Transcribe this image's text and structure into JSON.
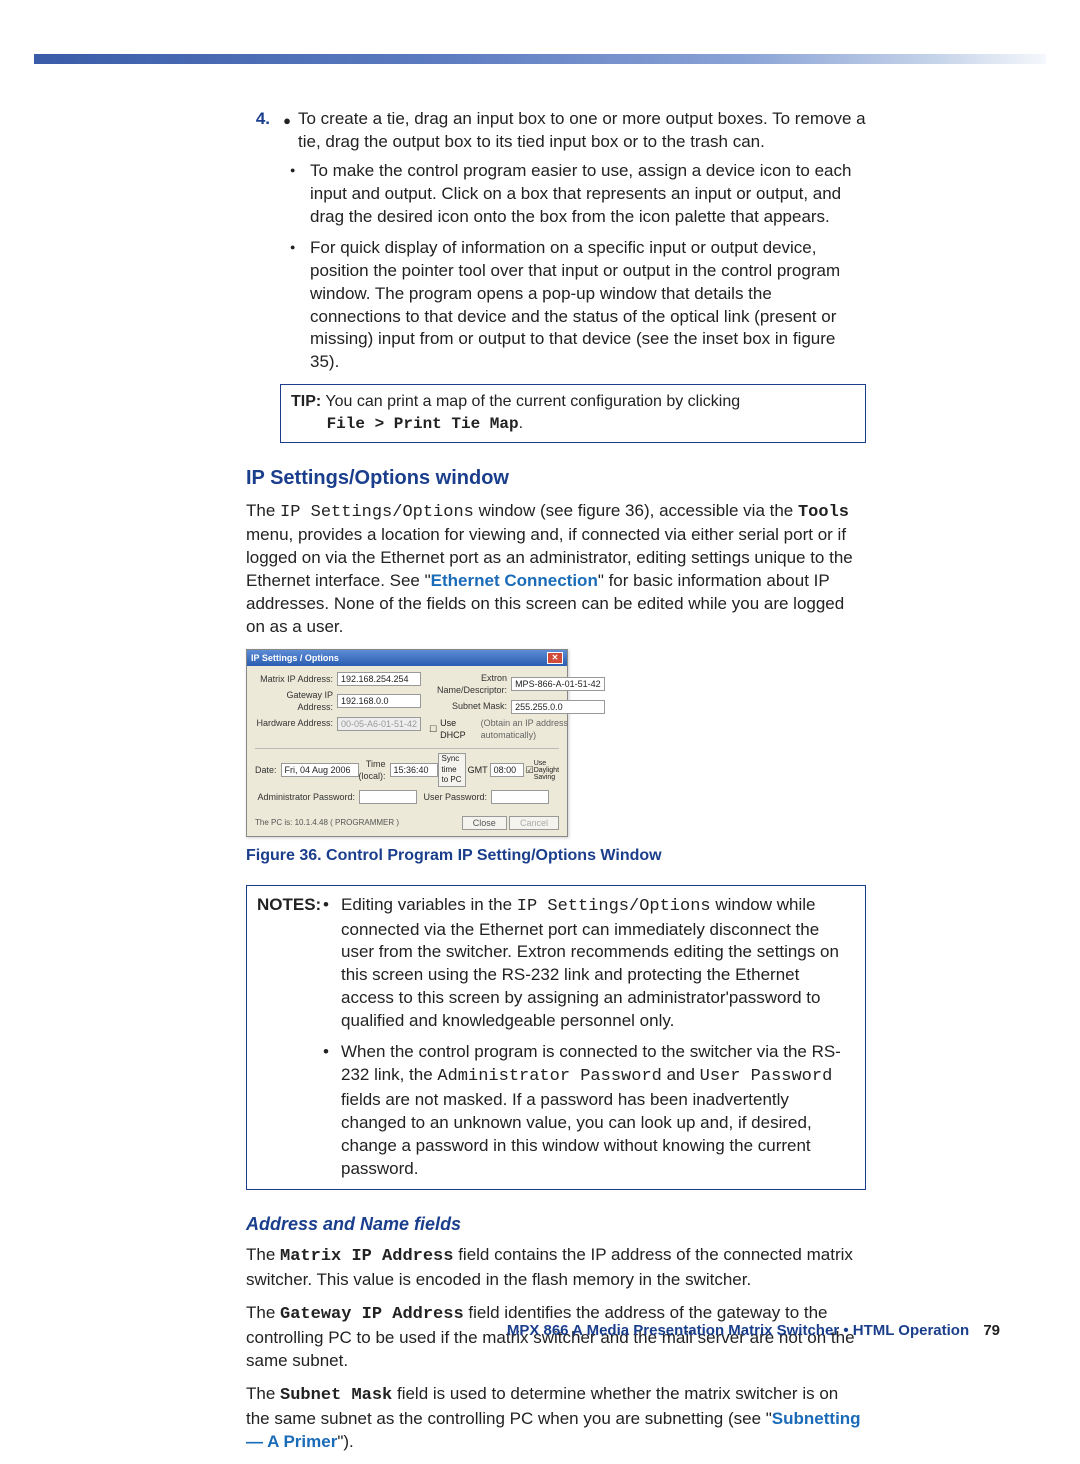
{
  "step4": {
    "number": "4.",
    "text": "To create a tie, drag an input box to one or more output boxes. To remove a tie, drag the output box to its tied input box or to the trash can.",
    "sub": [
      "To make the control program easier to use, assign a device icon to each input and output. Click on a box that represents an input or output, and drag the desired icon onto the box from the icon palette that appears.",
      "For quick display of information on a specific input or output device, position the pointer tool over that input or output in the control program window. The program opens a pop-up window that details the connections to that device and the status of the optical link (present or missing) input from or output to that device (see the inset box in figure 35)."
    ]
  },
  "tip": {
    "label": "TIP:",
    "text": "You can print a map of the current configuration by clicking ",
    "mono": "File > Print Tie Map",
    "tail": "."
  },
  "section": {
    "title": "IP Settings/Options window",
    "para_a": "The ",
    "mono1": "IP Settings/Options",
    "para_b": " window (see figure 36), accessible via the ",
    "mono2": "Tools",
    "para_c": " menu, provides a location for viewing and, if connected via either serial port or if logged on via the Ethernet port as an administrator, editing settings unique to the Ethernet interface. See \"",
    "link": "Ethernet Connection",
    "para_d": "\" for basic information about IP addresses. None of the fields on this screen can be edited while you are logged on as a user."
  },
  "dialog": {
    "title": "IP Settings / Options",
    "rows": {
      "matrix_ip_lbl": "Matrix IP Address:",
      "matrix_ip_val": "192.168.254.254",
      "gateway_lbl": "Gateway IP Address:",
      "gateway_val": "192.168.0.0",
      "hw_lbl": "Hardware Address:",
      "hw_val": "00-05-A6-01-51-42",
      "name_lbl": "Extron Name/Descriptor:",
      "name_val": "MPS-866-A-01-51-42",
      "subnet_lbl": "Subnet Mask:",
      "subnet_val": "255.255.0.0",
      "dhcp_lbl": "Use DHCP",
      "dhcp_hint": "(Obtain an IP address automatically)",
      "date_lbl": "Date:",
      "date_val": "Fri, 04 Aug 2006",
      "time_lbl": "Time (local):",
      "time_val": "15:36:40",
      "sync_btn": "Sync time to PC",
      "gmt_lbl": "GMT",
      "gmt_val": "08:00",
      "daylight_lbl": "Use Daylight Saving",
      "admin_lbl": "Administrator Password:",
      "user_lbl": "User Password:"
    },
    "footer": "The PC is: 10.1.4.48  ( PROGRAMMER )",
    "close_btn": "Close",
    "cancel_btn": "Cancel"
  },
  "figcap": "Figure 36. Control Program IP Setting/Options Window",
  "notes": {
    "label": "NOTES:",
    "items": [
      {
        "a": "Editing variables in the ",
        "m1": "IP Settings/Options",
        "b": " window while connected via the Ethernet port can immediately disconnect the user from the switcher. Extron recommends editing the settings on this screen using the RS-232 link and protecting the Ethernet access to this screen by assigning an administrator'password to qualified and knowledgeable personnel only."
      },
      {
        "a": "When the control program is connected to the switcher via the RS-232 link, the ",
        "m1": "Administrator Password",
        "b": " and ",
        "m2": "User Password",
        "c": " fields are not masked. If a password has been inadvertently changed to an unknown value, you can look up and, if desired, change a password in this window without knowing the current password."
      }
    ]
  },
  "subsection": {
    "title": "Address and Name fields",
    "p1_a": "The ",
    "p1_m": "Matrix IP Address",
    "p1_b": " field contains the IP address of the connected matrix switcher. This value is encoded in the flash memory in the switcher.",
    "p2_a": "The ",
    "p2_m": "Gateway IP Address",
    "p2_b": " field identifies the address of the gateway to the controlling PC to be used if the matrix switcher and the mail server are not on the same subnet.",
    "p3_a": "The ",
    "p3_m": "Subnet Mask",
    "p3_b": " field is used to determine whether the matrix switcher is on the same subnet as the controlling PC when you are subnetting (see \"",
    "p3_link": "Subnetting — A Primer",
    "p3_c": "\")."
  },
  "footer": {
    "text": "MPX 866 A Media Presentation Matrix Switcher • HTML Operation",
    "page": "79"
  }
}
